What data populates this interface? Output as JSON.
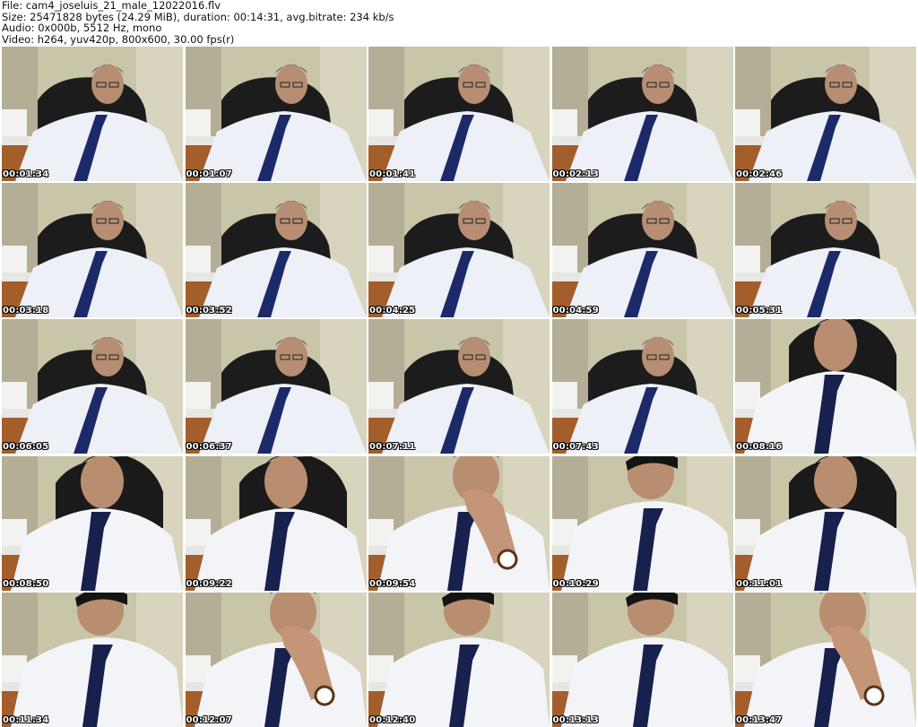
{
  "header": {
    "file_line": "File: cam4_joseluis_21_male_12022016.flv",
    "size_line": "Size: 25471828 bytes (24.29 MiB), duration: 00:14:31, avg.bitrate: 234 kb/s",
    "audio_line": "Audio: 0x000b, 5512 Hz, mono",
    "video_line": "Video: h264, yuv420p, 800x600, 30.00 fps(r)"
  },
  "thumbnails": [
    {
      "timestamp": "00:01:34",
      "scene": "seated"
    },
    {
      "timestamp": "00:01:07",
      "scene": "seated"
    },
    {
      "timestamp": "00:01:41",
      "scene": "seated"
    },
    {
      "timestamp": "00:02:13",
      "scene": "seated"
    },
    {
      "timestamp": "00:02:46",
      "scene": "seated"
    },
    {
      "timestamp": "00:03:18",
      "scene": "seated"
    },
    {
      "timestamp": "00:03:52",
      "scene": "seated"
    },
    {
      "timestamp": "00:04:25",
      "scene": "seated"
    },
    {
      "timestamp": "00:04:59",
      "scene": "seated"
    },
    {
      "timestamp": "00:05:31",
      "scene": "seated"
    },
    {
      "timestamp": "00:06:05",
      "scene": "seated"
    },
    {
      "timestamp": "00:06:37",
      "scene": "seated"
    },
    {
      "timestamp": "00:07:11",
      "scene": "seated"
    },
    {
      "timestamp": "00:07:43",
      "scene": "seated"
    },
    {
      "timestamp": "00:08:16",
      "scene": "close"
    },
    {
      "timestamp": "00:08:50",
      "scene": "close"
    },
    {
      "timestamp": "00:09:22",
      "scene": "close"
    },
    {
      "timestamp": "00:09:54",
      "scene": "hand-chin"
    },
    {
      "timestamp": "00:10:29",
      "scene": "looking-down"
    },
    {
      "timestamp": "00:11:01",
      "scene": "close"
    },
    {
      "timestamp": "00:11:34",
      "scene": "looking-down"
    },
    {
      "timestamp": "00:12:07",
      "scene": "hand-chin"
    },
    {
      "timestamp": "00:12:40",
      "scene": "looking-down"
    },
    {
      "timestamp": "00:13:13",
      "scene": "looking-down"
    },
    {
      "timestamp": "00:13:47",
      "scene": "hand-chin"
    }
  ]
}
